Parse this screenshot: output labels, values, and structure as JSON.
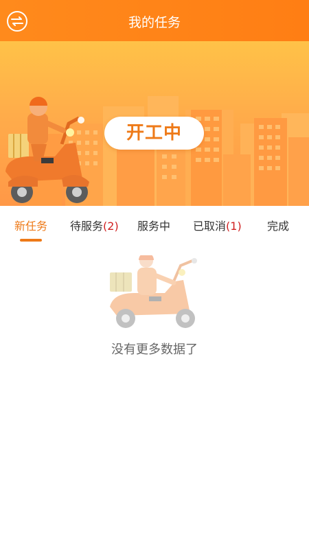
{
  "header": {
    "title": "我的任务"
  },
  "banner": {
    "status_label": "开工中"
  },
  "tabs": [
    {
      "label": "新任务",
      "count": ""
    },
    {
      "label": "待服务",
      "count": "(2)"
    },
    {
      "label": "服务中",
      "count": ""
    },
    {
      "label": "已取消",
      "count": "(1)"
    },
    {
      "label": "完成",
      "count": ""
    }
  ],
  "active_tab": "新任务",
  "empty_state": {
    "message": "没有更多数据了"
  },
  "colors": {
    "accent": "#ee7a18",
    "header": "#ff8a1c",
    "count": "#d02020"
  }
}
